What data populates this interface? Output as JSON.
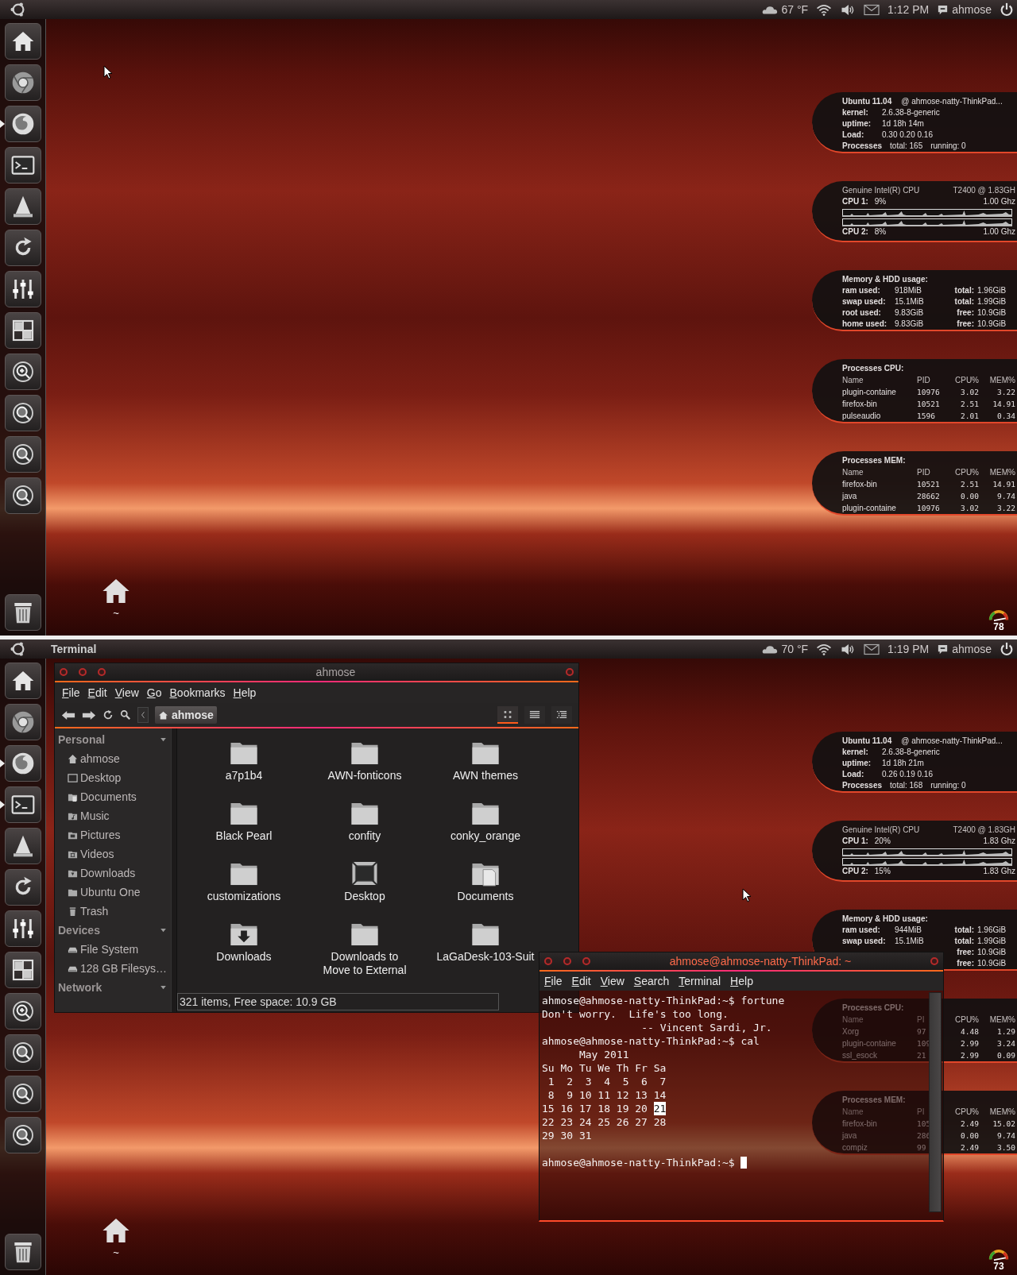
{
  "screens": [
    {
      "panel": {
        "weather": "67 °F",
        "clock": "1:12 PM",
        "user": "ahmose"
      },
      "launcher": [
        {
          "kind": "home",
          "running": false
        },
        {
          "kind": "chromium",
          "running": false
        },
        {
          "kind": "firefox",
          "running": true
        },
        {
          "kind": "terminal",
          "running": false
        },
        {
          "kind": "cone",
          "running": false
        },
        {
          "kind": "update",
          "running": false
        },
        {
          "kind": "mixer",
          "running": false
        },
        {
          "kind": "workspaces",
          "running": false
        },
        {
          "kind": "zoom_in",
          "running": false
        },
        {
          "kind": "zoom",
          "running": false
        },
        {
          "kind": "zoom",
          "running": false
        },
        {
          "kind": "ask",
          "running": false
        }
      ],
      "desktop_icon": {
        "label": "~"
      },
      "gauge": {
        "value": "78"
      },
      "conky": [
        {
          "kind": "info",
          "header": [
            "Ubuntu 11.04",
            "@ ahmose-natty-ThinkPad..."
          ],
          "rows": [
            [
              "kernel:",
              "2.6.38-8-generic"
            ],
            [
              "uptime:",
              "1d 18h 14m"
            ],
            [
              "Load:",
              "0.30 0.20 0.16"
            ]
          ],
          "footer": [
            "Processes",
            "total: 165",
            "running: 0"
          ]
        },
        {
          "kind": "cpu",
          "header": [
            "Genuine Intel(R) CPU",
            "T2400  @ 1.83GH"
          ],
          "cores": [
            [
              "CPU 1:",
              "9%",
              "1.00 Ghz"
            ],
            [
              "CPU 2:",
              "8%",
              "1.00 Ghz"
            ]
          ]
        },
        {
          "kind": "mem",
          "title": "Memory & HDD usage:",
          "rows": [
            [
              "ram used:",
              "918MiB",
              "total:",
              "1.96GiB"
            ],
            [
              "swap used:",
              "15.1MiB",
              "total:",
              "1.99GiB"
            ],
            [
              "root used:",
              "9.83GiB",
              "free:",
              "10.9GiB"
            ],
            [
              "home used:",
              "9.83GiB",
              "free:",
              "10.9GiB"
            ]
          ]
        },
        {
          "kind": "procs",
          "title": "Processes CPU:",
          "header": [
            "Name",
            "PID",
            "CPU%",
            "MEM%"
          ],
          "rows": [
            [
              "plugin-containe",
              "10976",
              "3.02",
              "3.22"
            ],
            [
              "firefox-bin",
              "10521",
              "2.51",
              "14.91"
            ],
            [
              "pulseaudio",
              "1596",
              "2.01",
              "0.34"
            ]
          ]
        },
        {
          "kind": "procs",
          "title": "Processes MEM:",
          "header": [
            "Name",
            "PID",
            "CPU%",
            "MEM%"
          ],
          "rows": [
            [
              "firefox-bin",
              "10521",
              "2.51",
              "14.91"
            ],
            [
              "java",
              "28662",
              "0.00",
              "9.74"
            ],
            [
              "plugin-containe",
              "10976",
              "3.02",
              "3.22"
            ]
          ]
        }
      ]
    },
    {
      "panel": {
        "app_title": "Terminal",
        "weather": "70 °F",
        "clock": "1:19 PM",
        "user": "ahmose"
      },
      "launcher": [
        {
          "kind": "home",
          "running": false
        },
        {
          "kind": "chromium",
          "running": false
        },
        {
          "kind": "firefox",
          "running": true
        },
        {
          "kind": "terminal",
          "running": true
        },
        {
          "kind": "cone",
          "running": false
        },
        {
          "kind": "update",
          "running": false
        },
        {
          "kind": "mixer",
          "running": false
        },
        {
          "kind": "workspaces",
          "running": false
        },
        {
          "kind": "zoom_in",
          "running": false
        },
        {
          "kind": "zoom",
          "running": false
        },
        {
          "kind": "zoom",
          "running": false
        },
        {
          "kind": "ask",
          "running": false
        }
      ],
      "desktop_icon": {
        "label": "~"
      },
      "gauge": {
        "value": "73"
      },
      "conky": [
        {
          "kind": "info",
          "header": [
            "Ubuntu 11.04",
            "@ ahmose-natty-ThinkPad..."
          ],
          "rows": [
            [
              "kernel:",
              "2.6.38-8-generic"
            ],
            [
              "uptime:",
              "1d 18h 21m"
            ],
            [
              "Load:",
              "0.26 0.19 0.16"
            ]
          ],
          "footer": [
            "Processes",
            "total: 168",
            "running: 0"
          ]
        },
        {
          "kind": "cpu",
          "header": [
            "Genuine Intel(R) CPU",
            "T2400  @ 1.83GH"
          ],
          "cores": [
            [
              "CPU 1:",
              "20%",
              "1.83 Ghz"
            ],
            [
              "CPU 2:",
              "15%",
              "1.83 Ghz"
            ]
          ]
        },
        {
          "kind": "mem",
          "title": "Memory & HDD usage:",
          "rows": [
            [
              "ram used:",
              "944MiB",
              "total:",
              "1.96GiB"
            ],
            [
              "swap used:",
              "15.1MiB",
              "total:",
              "1.99GiB"
            ],
            [
              null,
              null,
              "free:",
              "10.9GiB"
            ],
            [
              null,
              null,
              "free:",
              "10.9GiB"
            ]
          ]
        },
        {
          "kind": "procs",
          "title": "Processes CPU:",
          "header": [
            "Name",
            "PI",
            "CPU%",
            "MEM%"
          ],
          "rows": [
            [
              "Xorg",
              "97",
              "4.48",
              "1.29"
            ],
            [
              "plugin-containe",
              "109",
              "2.99",
              "3.24"
            ],
            [
              "ssl_esock",
              "21",
              "2.99",
              "0.09"
            ]
          ]
        },
        {
          "kind": "procs",
          "title": "Processes MEM:",
          "header": [
            "Name",
            "PI",
            "CPU%",
            "MEM%"
          ],
          "rows": [
            [
              "firefox-bin",
              "105",
              "2.49",
              "15.02"
            ],
            [
              "java",
              "286",
              "0.00",
              "9.74"
            ],
            [
              "compiz",
              "99",
              "2.49",
              "3.50"
            ]
          ]
        }
      ],
      "file_manager": {
        "title": "ahmose",
        "menu": [
          "File",
          "Edit",
          "View",
          "Go",
          "Bookmarks",
          "Help"
        ],
        "location": "ahmose",
        "view_modes": [
          {
            "kind": "icons",
            "selected": true
          },
          {
            "kind": "list",
            "selected": false
          },
          {
            "kind": "compact",
            "selected": false
          }
        ],
        "sidebar": [
          {
            "heading": "Personal",
            "items": [
              {
                "kind": "home",
                "label": "ahmose"
              },
              {
                "kind": "desktop",
                "label": "Desktop"
              },
              {
                "kind": "documents",
                "label": "Documents"
              },
              {
                "kind": "music",
                "label": "Music"
              },
              {
                "kind": "pictures",
                "label": "Pictures"
              },
              {
                "kind": "videos",
                "label": "Videos"
              },
              {
                "kind": "downloads",
                "label": "Downloads"
              },
              {
                "kind": "folder",
                "label": "Ubuntu One"
              },
              {
                "kind": "trash",
                "label": "Trash"
              }
            ]
          },
          {
            "heading": "Devices",
            "items": [
              {
                "kind": "drive",
                "label": "File System"
              },
              {
                "kind": "drive",
                "label": "128 GB Filesys…"
              }
            ]
          },
          {
            "heading": "Network"
          }
        ],
        "items": [
          {
            "kind": "folder",
            "label": "a7p1b4"
          },
          {
            "kind": "folder",
            "label": "AWN-fonticons"
          },
          {
            "kind": "folder",
            "label": "AWN themes"
          },
          {
            "kind": "folder",
            "label": "Black Pearl"
          },
          {
            "kind": "folder",
            "label": "confity"
          },
          {
            "kind": "folder",
            "label": "conky_orange"
          },
          {
            "kind": "folder",
            "label": "customizations"
          },
          {
            "kind": "desktop",
            "label": "Desktop"
          },
          {
            "kind": "documents",
            "label": "Documents"
          },
          {
            "kind": "downloads",
            "label": "Downloads"
          },
          {
            "kind": "folder",
            "label": "Downloads to Move to External"
          },
          {
            "kind": "folder",
            "label": "LaGaDesk-103-Suit"
          }
        ],
        "status": "321 items, Free space: 10.9 GB"
      },
      "terminal": {
        "title": "ahmose@ahmose-natty-ThinkPad: ~",
        "menu": [
          "File",
          "Edit",
          "View",
          "Search",
          "Terminal",
          "Help"
        ],
        "lines": [
          "ahmose@ahmose-natty-ThinkPad:~$ fortune",
          "Don't worry.  Life's too long.",
          "                -- Vincent Sardi, Jr.",
          "ahmose@ahmose-natty-ThinkPad:~$ cal"
        ],
        "calendar": {
          "title": "May 2011",
          "weekdays": [
            "Su",
            "Mo",
            "Tu",
            "We",
            "Th",
            "Fr",
            "Sa"
          ],
          "weeks": [
            [
              {
                "day": "1",
                "selected": false
              },
              {
                "day": "2",
                "selected": false
              },
              {
                "day": "3",
                "selected": false
              },
              {
                "day": "4",
                "selected": false
              },
              {
                "day": "5",
                "selected": false
              },
              {
                "day": "6",
                "selected": false
              },
              {
                "day": "7",
                "selected": false
              }
            ],
            [
              {
                "day": "8",
                "selected": false
              },
              {
                "day": "9",
                "selected": false
              },
              {
                "day": "10",
                "selected": false
              },
              {
                "day": "11",
                "selected": false
              },
              {
                "day": "12",
                "selected": false
              },
              {
                "day": "13",
                "selected": false
              },
              {
                "day": "14",
                "selected": false
              }
            ],
            [
              {
                "day": "15",
                "selected": false
              },
              {
                "day": "16",
                "selected": false
              },
              {
                "day": "17",
                "selected": false
              },
              {
                "day": "18",
                "selected": false
              },
              {
                "day": "19",
                "selected": false
              },
              {
                "day": "20",
                "selected": false
              },
              {
                "day": "21",
                "selected": true
              }
            ],
            [
              {
                "day": "22",
                "selected": false
              },
              {
                "day": "23",
                "selected": false
              },
              {
                "day": "24",
                "selected": false
              },
              {
                "day": "25",
                "selected": false
              },
              {
                "day": "26",
                "selected": false
              },
              {
                "day": "27",
                "selected": false
              },
              {
                "day": "28",
                "selected": false
              }
            ],
            [
              {
                "day": "29",
                "selected": false
              },
              {
                "day": "30",
                "selected": false
              },
              {
                "day": "31",
                "selected": false
              }
            ]
          ]
        },
        "prompt": "ahmose@ahmose-natty-ThinkPad:~$"
      }
    }
  ]
}
